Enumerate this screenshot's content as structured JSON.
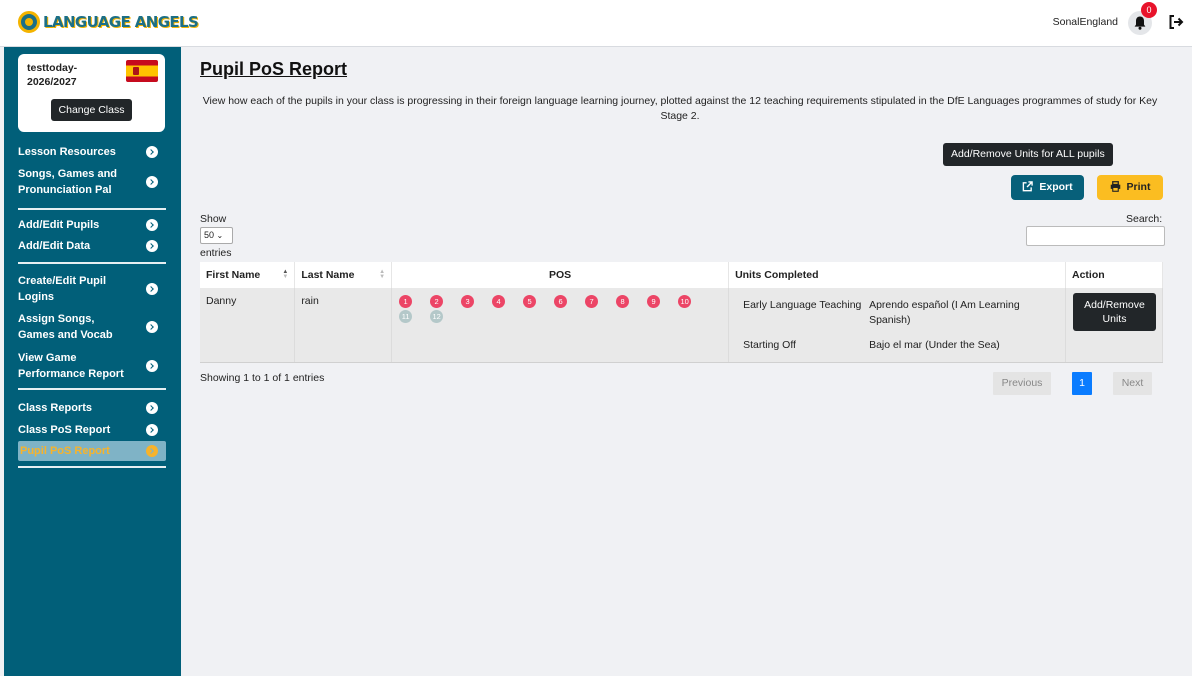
{
  "header": {
    "logo_text": "LANGUAGE ANGELS",
    "user_name": "SonalEngland",
    "notification_count": "0"
  },
  "sidebar": {
    "class_name": "testtoday-2026/2027",
    "change_class_label": "Change Class",
    "items": [
      {
        "label": "Lesson Resources"
      },
      {
        "label": "Songs, Games and Pronunciation Pal"
      },
      {
        "label": "Add/Edit Pupils"
      },
      {
        "label": "Add/Edit Data"
      },
      {
        "label": "Create/Edit Pupil Logins"
      },
      {
        "label": "Assign Songs, Games and Vocab"
      },
      {
        "label": "View Game Performance Report"
      },
      {
        "label": "Class Reports"
      },
      {
        "label": "Class PoS Report"
      },
      {
        "label": "Pupil PoS Report"
      }
    ],
    "active_item": "Pupil PoS Report",
    "colors": {
      "background": "#015f79",
      "active_text": "#f7b32b"
    }
  },
  "main": {
    "title": "Pupil PoS Report",
    "description": "View how each of the pupils in your class is progressing in their foreign language learning journey, plotted against the 12 teaching requirements stipulated in the DfE Languages programmes of study for Key Stage 2.",
    "add_remove_all_label": "Add/Remove Units for ALL pupils",
    "export_label": "Export",
    "print_label": "Print",
    "show_label": "Show",
    "entries_value": "50",
    "entries_label": "entries",
    "search_label": "Search:",
    "search_value": "",
    "table": {
      "headers": [
        "First Name",
        "Last Name",
        "POS",
        "Units Completed",
        "Action"
      ],
      "rows": [
        {
          "first_name": "Danny",
          "last_name": "rain",
          "pos_completed": [
            "1",
            "2",
            "3",
            "4",
            "5",
            "6",
            "7",
            "8",
            "9",
            "10"
          ],
          "pos_remaining": [
            "11",
            "12"
          ],
          "units": [
            {
              "stage": "Early Language Teaching",
              "unit": "Aprendo español (I Am Learning Spanish)"
            },
            {
              "stage": "Starting Off",
              "unit": "Bajo el mar (Under the Sea)"
            }
          ],
          "action_label": "Add/Remove Units"
        }
      ]
    },
    "showing_text": "Showing 1 to 1 of 1 entries",
    "pagination": {
      "previous": "Previous",
      "current": "1",
      "next": "Next"
    },
    "colors": {
      "pos_done": "#ec4566",
      "pos_todo": "#b4c8c9",
      "export": "#07607a",
      "print": "#fbbd21",
      "page_active": "#0a7cff"
    }
  }
}
